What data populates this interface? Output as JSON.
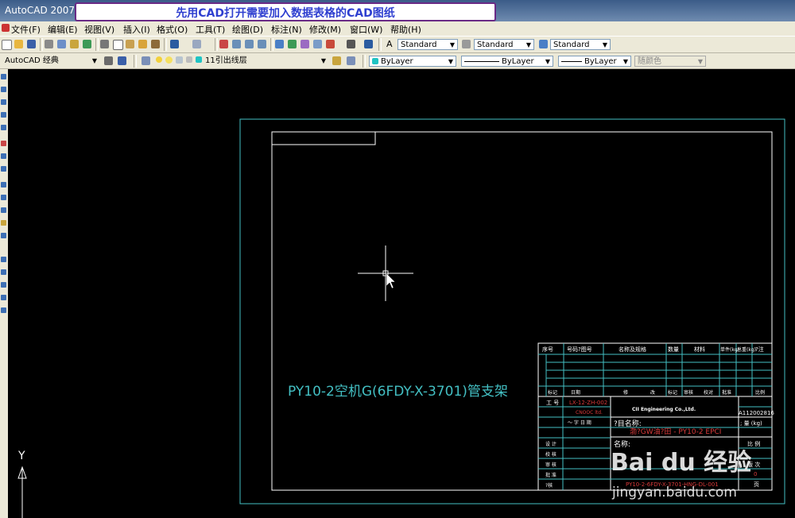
{
  "window": {
    "title": "AutoCAD 2007"
  },
  "banner": {
    "text": "先用CAD打开需要加入数据表格的CAD图纸"
  },
  "menu": {
    "items": [
      "文件(F)",
      "编辑(E)",
      "视图(V)",
      "插入(I)",
      "格式(O)",
      "工具(T)",
      "绘图(D)",
      "标注(N)",
      "修改(M)",
      "窗口(W)",
      "帮助(H)"
    ]
  },
  "styles": {
    "text_style": "Standard",
    "dim_style": "Standard",
    "table_style": "Standard"
  },
  "workspace": {
    "name": "AutoCAD 经典"
  },
  "layer": {
    "current": "11引出线层"
  },
  "properties": {
    "color": "ByLayer",
    "linetype": "ByLayer",
    "lineweight": "ByLayer",
    "plotstyle": "随颜色"
  },
  "drawing": {
    "label": "PY10-2空机G(6FDY-X-3701)管支架",
    "ucs_label": "Y",
    "title_block": {
      "header": [
        "序号",
        "号码?图号",
        "名称及规格",
        "数量",
        "材料",
        "单件(kg)",
        "总重(kg)",
        "?注"
      ],
      "footer": [
        "标记",
        "次数",
        "日期",
        "修",
        "改",
        "标记",
        "审核",
        "校对",
        "批准",
        "比例"
      ],
      "doc_no": "LX-12-ZH-002",
      "company": "CNOOC ltd.",
      "company_en": "CII Engineering Co.,Ltd.",
      "project_label": "?目名称:",
      "project_value": "渤?GW油?田 - PY10-2 EPCI",
      "name_label": "名称:",
      "code": "A112002816",
      "weight_label": "; 量 (kg)",
      "scale_label": "比 例",
      "sheet_label": "版 次",
      "sheet_value": "0",
      "sheet_count_label": "页",
      "bottom_code": "PY10-2-6FDY-X-3701-HNG-DL-001",
      "side_rows": [
        "设 计",
        "校 核",
        "审 核",
        "批 准",
        "?核",
        "批 准"
      ]
    }
  },
  "watermark": {
    "logo": "Bai du 经验",
    "url": "jingyan.baidu.com"
  },
  "colors": {
    "cyan": "#43bfc3",
    "white": "#ffffff",
    "red": "#d83a3a",
    "bg": "#000000"
  }
}
